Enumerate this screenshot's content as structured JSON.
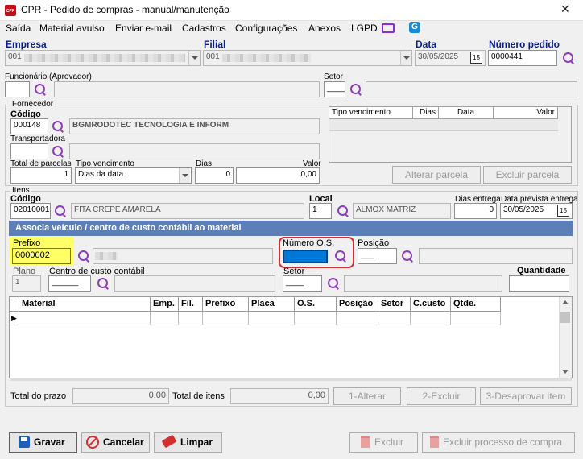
{
  "window": {
    "title": "CPR - Pedido de compras - manual/manutenção",
    "icon_letter": "CPR",
    "close_glyph": "✕"
  },
  "menu": [
    {
      "label": "Saída"
    },
    {
      "label": "Material avulso"
    },
    {
      "label": "Enviar e-mail"
    },
    {
      "label": "Cadastros"
    },
    {
      "label": "Configurações"
    },
    {
      "label": "Anexos"
    },
    {
      "label": "LGPD"
    }
  ],
  "header": {
    "empresa_label": "Empresa",
    "empresa_value": "001",
    "filial_label": "Filial",
    "filial_value": "001",
    "data_label": "Data",
    "data_value": "30/05/2025",
    "calendar_text": "15",
    "numero_pedido_label": "Número pedido",
    "numero_pedido_value": "0000441",
    "funcionario_label": "Funcionário (Aprovador)",
    "funcionario_value": "",
    "setor_label": "Setor",
    "setor_value": "____"
  },
  "fornecedor": {
    "group_title": "Fornecedor",
    "codigo_label": "Código",
    "codigo_value": "000148",
    "nome_value": "BGMRODOTEC TECNOLOGIA E INFORM",
    "transportadora_label": "Transportadora",
    "total_parcelas_label": "Total de parcelas",
    "total_parcelas_value": "1",
    "tipo_vencimento_label": "Tipo vencimento",
    "tipo_vencimento_value": "Dias da data",
    "dias_label": "Dias",
    "dias_value": "0",
    "valor_label": "Valor",
    "valor_value": "0,00",
    "table_headers": [
      "Tipo vencimento",
      "Dias",
      "Data",
      "Valor"
    ],
    "alterar_parcela": "Alterar parcela",
    "excluir_parcela": "Excluir parcela"
  },
  "itens": {
    "group_title": "Itens",
    "codigo_label": "Código",
    "codigo_value": "02010001",
    "descricao_value": "FITA CREPE AMARELA",
    "local_label": "Local",
    "local_value": "1",
    "local_nome": "ALMOX MATRIZ",
    "dias_entrega_label": "Dias entrega",
    "dias_entrega_value": "0",
    "data_prevista_label": "Data prevista entrega",
    "data_prevista_value": "30/05/2025",
    "calendar_text": "15"
  },
  "associa": {
    "banner": "Associa veículo / centro de custo contábil ao material",
    "prefixo_label": "Prefixo",
    "prefixo_value": "0000002",
    "numero_os_label": "Número O.S.",
    "numero_os_value": "",
    "posicao_label": "Posição",
    "posicao_value": "___",
    "plano_label": "Plano",
    "plano_value": "1",
    "centro_custo_label": "Centro de custo contábil",
    "centro_custo_value": "______",
    "setor_label": "Setor",
    "setor_value": "____",
    "quantidade_label": "Quantidade",
    "quantidade_value": ""
  },
  "grid": {
    "headers": [
      "Material",
      "Emp.",
      "Fil.",
      "Prefixo",
      "Placa",
      "O.S.",
      "Posição",
      "Setor",
      "C.custo",
      "Qtde."
    ],
    "row_indicator": "▶"
  },
  "totals": {
    "total_prazo_label": "Total do prazo",
    "total_prazo_value": "0,00",
    "total_itens_label": "Total de itens",
    "total_itens_value": "0,00",
    "alterar": "1-Alterar",
    "excluir": "2-Excluir",
    "desaprovar": "3-Desaprovar item"
  },
  "footer": {
    "gravar": "Gravar",
    "cancelar": "Cancelar",
    "limpar": "Limpar",
    "excluir": "Excluir",
    "excluir_processo": "Excluir processo de compra"
  },
  "colors": {
    "banner": "#5b7fb6",
    "highlight_yellow": "#ffff66",
    "os_focus": "#0078d7",
    "accent_red": "#d32f2f"
  }
}
